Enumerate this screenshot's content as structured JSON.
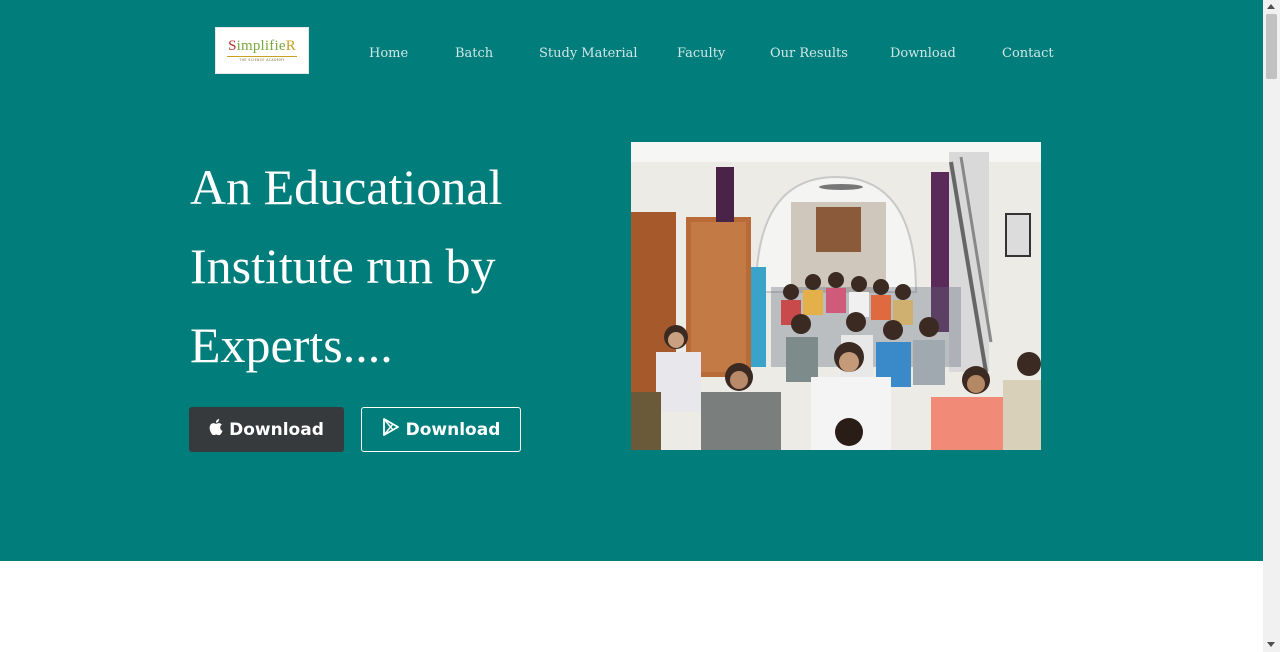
{
  "brand": {
    "logo_text_part1": "S",
    "logo_text_part2": "implifie",
    "logo_text_part3": "R",
    "logo_subtitle": "THE SCIENCE ACADEMY"
  },
  "nav": {
    "items": [
      {
        "label": "Home"
      },
      {
        "label": "Batch"
      },
      {
        "label": "Study Material"
      },
      {
        "label": "Faculty"
      },
      {
        "label": "Our Results"
      },
      {
        "label": "Download"
      },
      {
        "label": "Contact"
      }
    ]
  },
  "hero": {
    "headline_line1": "An Educational",
    "headline_line2": "Institute run by",
    "headline_line3": "Experts....",
    "apple_button_label": "Download",
    "play_button_label": "Download",
    "photo_alt": "students in classroom photo"
  },
  "colors": {
    "hero_background": "#017d7b",
    "apple_button": "#363a3d",
    "nav_text": "#cfe7e6"
  },
  "icons": {
    "apple": "apple-icon",
    "play": "play-store-icon"
  }
}
